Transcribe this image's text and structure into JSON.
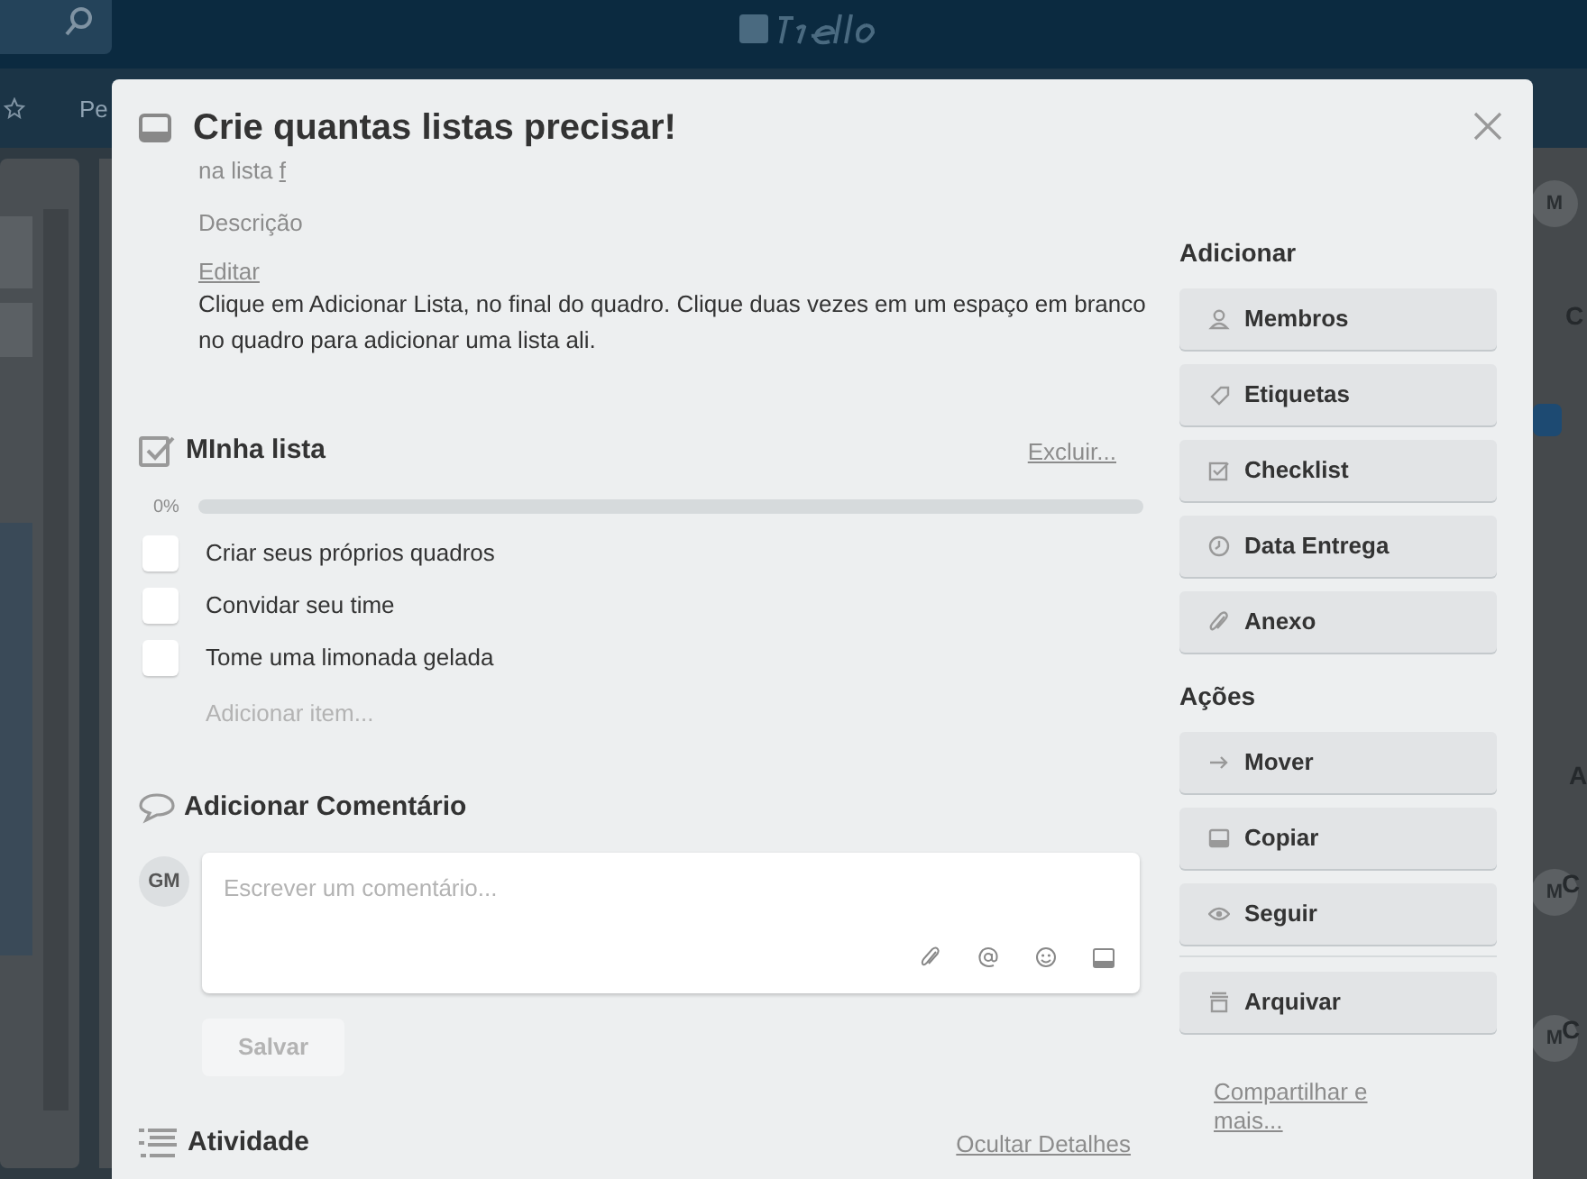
{
  "header": {
    "board_name": "Pe"
  },
  "background_fragments": [
    {
      "text": "M",
      "kind": "avatar"
    },
    {
      "text": "C",
      "kind": "label"
    },
    {
      "text": "A",
      "kind": "label"
    },
    {
      "text": "M",
      "kind": "avatar"
    },
    {
      "text": "C",
      "kind": "label"
    },
    {
      "text": "M",
      "kind": "avatar"
    },
    {
      "text": "C",
      "kind": "label"
    }
  ],
  "card": {
    "title": "Crie quantas listas precisar!",
    "list_prefix": "na lista",
    "list_name": "f",
    "description_label": "Descrição",
    "edit_link": "Editar",
    "description": "Clique em Adicionar Lista, no final do quadro. Clique duas vezes em um espaço em branco no quadro para adicionar uma lista ali.",
    "checklist": {
      "title": "MInha lista",
      "delete_link": "Excluir...",
      "percent": "0%",
      "level": 0,
      "items": [
        {
          "text": "Criar seus próprios quadros",
          "checked": false
        },
        {
          "text": "Convidar seu time",
          "checked": false
        },
        {
          "text": "Tome uma limonada gelada",
          "checked": false
        }
      ],
      "add_item": "Adicionar item..."
    },
    "comment": {
      "title": "Adicionar Comentário",
      "avatar": "GM",
      "placeholder": "Escrever um comentário...",
      "save": "Salvar"
    },
    "activity": {
      "title": "Atividade",
      "toggle": "Ocultar Detalhes"
    }
  },
  "sidebar": {
    "sections": [
      {
        "title": "Adicionar",
        "buttons": [
          {
            "label": "Membros",
            "kind": "members"
          },
          {
            "label": "Etiquetas",
            "kind": "labels"
          },
          {
            "label": "Checklist",
            "kind": "checklist"
          },
          {
            "label": "Data Entrega",
            "kind": "due"
          },
          {
            "label": "Anexo",
            "kind": "attachment"
          }
        ]
      },
      {
        "title": "Ações",
        "buttons": [
          {
            "label": "Mover",
            "kind": "move"
          },
          {
            "label": "Copiar",
            "kind": "copy"
          },
          {
            "label": "Seguir",
            "kind": "watch"
          },
          {
            "label": "Arquivar",
            "kind": "archive",
            "separated": true
          }
        ]
      }
    ],
    "share_link": "Compartilhar e mais..."
  }
}
